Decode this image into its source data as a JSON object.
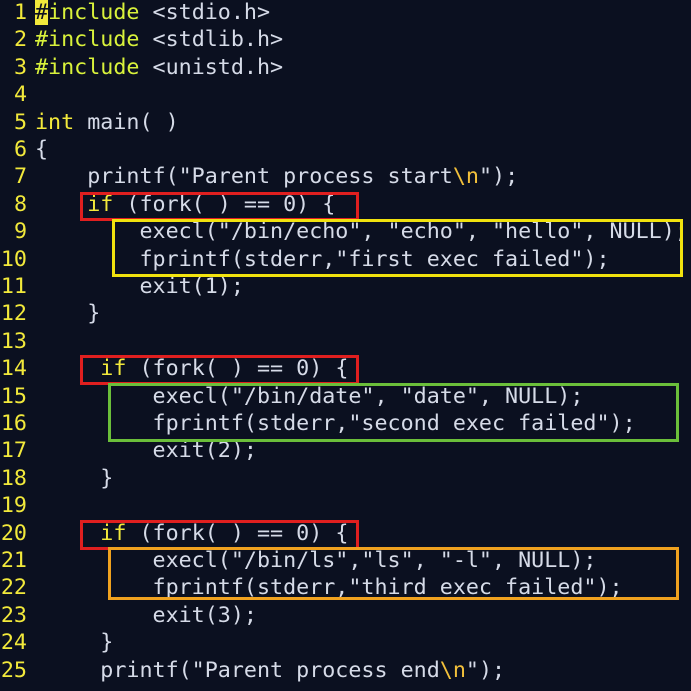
{
  "colors": {
    "background": "#0b1020",
    "line_number": "#f2e93b",
    "code_text": "#d6dbe8",
    "keyword": "#f2e93b",
    "escape": "#f2c03b",
    "cursor": "#f2e93b",
    "box_red": "#e01f1f",
    "box_yellow": "#f1e20e",
    "box_green": "#6bbf3a",
    "box_orange": "#f0a21f"
  },
  "lines": [
    {
      "n": "1",
      "parts": [
        [
          "cursor",
          "#"
        ],
        [
          "pp",
          "include"
        ],
        [
          "hdr",
          " <stdio.h>"
        ]
      ]
    },
    {
      "n": "2",
      "parts": [
        [
          "pp",
          "#include"
        ],
        [
          "hdr",
          " <stdlib.h>"
        ]
      ]
    },
    {
      "n": "3",
      "parts": [
        [
          "pp",
          "#include"
        ],
        [
          "hdr",
          " <unistd.h>"
        ]
      ]
    },
    {
      "n": "4",
      "parts": []
    },
    {
      "n": "5",
      "parts": [
        [
          "type",
          "int"
        ],
        [
          "fn",
          " main( )"
        ]
      ]
    },
    {
      "n": "6",
      "parts": [
        [
          "punc",
          "{"
        ]
      ]
    },
    {
      "n": "7",
      "parts": [
        [
          "fn",
          "    printf(\"Parent process start"
        ],
        [
          "esc",
          "\\n"
        ],
        [
          "fn",
          "\");"
        ]
      ]
    },
    {
      "n": "8",
      "parts": [
        [
          "kw",
          "    if"
        ],
        [
          "fn",
          " (fork( ) == 0) {"
        ]
      ]
    },
    {
      "n": "9",
      "parts": [
        [
          "fn",
          "        execl(\"/bin/echo\", \"echo\", \"hello\", NULL);"
        ]
      ]
    },
    {
      "n": "10",
      "parts": [
        [
          "fn",
          "        fprintf(stderr,\"first exec failed\");"
        ]
      ]
    },
    {
      "n": "11",
      "parts": [
        [
          "fn",
          "        exit(1);"
        ]
      ]
    },
    {
      "n": "12",
      "parts": [
        [
          "fn",
          "    }"
        ]
      ]
    },
    {
      "n": "13",
      "parts": []
    },
    {
      "n": "14",
      "parts": [
        [
          "kw",
          "     if"
        ],
        [
          "fn",
          " (fork( ) == 0) {"
        ]
      ]
    },
    {
      "n": "15",
      "parts": [
        [
          "fn",
          "         execl(\"/bin/date\", \"date\", NULL);"
        ]
      ]
    },
    {
      "n": "16",
      "parts": [
        [
          "fn",
          "         fprintf(stderr,\"second exec failed\");"
        ]
      ]
    },
    {
      "n": "17",
      "parts": [
        [
          "fn",
          "         exit(2);"
        ]
      ]
    },
    {
      "n": "18",
      "parts": [
        [
          "fn",
          "     }"
        ]
      ]
    },
    {
      "n": "19",
      "parts": []
    },
    {
      "n": "20",
      "parts": [
        [
          "kw",
          "     if"
        ],
        [
          "fn",
          " (fork( ) == 0) {"
        ]
      ]
    },
    {
      "n": "21",
      "parts": [
        [
          "fn",
          "         execl(\"/bin/ls\",\"ls\", \"-l\", NULL);"
        ]
      ]
    },
    {
      "n": "22",
      "parts": [
        [
          "fn",
          "         fprintf(stderr,\"third exec failed\");"
        ]
      ]
    },
    {
      "n": "23",
      "parts": [
        [
          "fn",
          "         exit(3);"
        ]
      ]
    },
    {
      "n": "24",
      "parts": [
        [
          "fn",
          "     }"
        ]
      ]
    },
    {
      "n": "25",
      "parts": [
        [
          "fn",
          "     printf(\"Parent process end"
        ],
        [
          "esc",
          "\\n"
        ],
        [
          "fn",
          "\");"
        ]
      ]
    }
  ]
}
